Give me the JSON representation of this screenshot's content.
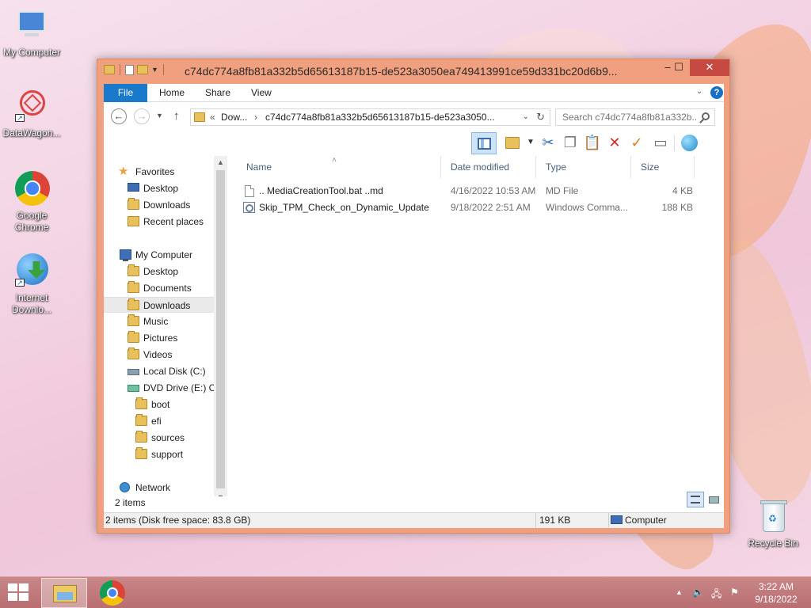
{
  "desktop": {
    "icons": [
      {
        "label": "My Computer"
      },
      {
        "label": "DataWagon..."
      },
      {
        "label": "Google Chrome"
      },
      {
        "label": "Internet Downlo..."
      },
      {
        "label": "Recycle Bin"
      }
    ]
  },
  "window": {
    "title": "c74dc774a8fb81a332b5d65613187b15-de523a3050ea749413991ce59d331bc20d6b9...",
    "controls": {
      "minimize": "–",
      "maximize": "☐",
      "close": "✕"
    }
  },
  "ribbon": {
    "tabs": [
      "File",
      "Home",
      "Share",
      "View"
    ]
  },
  "navigation": {
    "back": "←",
    "forward": "→",
    "up": "↑",
    "address_prefix": "«",
    "address_parent": "Dow...",
    "address_separator": "›",
    "address_current": "c74dc774a8fb81a332b5d65613187b15-de523a3050...",
    "search_placeholder": "Search c74dc774a8fb81a332b..."
  },
  "nav_pane": {
    "favorites": {
      "label": "Favorites",
      "items": [
        "Desktop",
        "Downloads",
        "Recent places"
      ]
    },
    "computer": {
      "label": "My Computer",
      "items": [
        "Desktop",
        "Documents",
        "Downloads",
        "Music",
        "Pictures",
        "Videos",
        "Local Disk (C:)",
        "DVD Drive (E:) CC"
      ],
      "dvd_children": [
        "boot",
        "efi",
        "sources",
        "support"
      ]
    },
    "network": {
      "label": "Network"
    }
  },
  "file_list": {
    "columns": [
      "Name",
      "Date modified",
      "Type",
      "Size"
    ],
    "rows": [
      {
        "name": ".. MediaCreationTool.bat ..md",
        "date": "4/16/2022 10:53 AM",
        "type": "MD File",
        "size": "4 KB"
      },
      {
        "name": "Skip_TPM_Check_on_Dynamic_Update",
        "date": "9/18/2022 2:51 AM",
        "type": "Windows Comma...",
        "size": "188 KB"
      }
    ]
  },
  "status": {
    "item_count": "2 items",
    "summary": "2 items (Disk free space: 83.8 GB)",
    "size": "191 KB",
    "location": "Computer"
  },
  "taskbar": {
    "time": "3:22 AM",
    "date": "9/18/2022"
  },
  "colors": {
    "window_frame": "#f0a07e",
    "file_tab": "#1979ca",
    "close_button": "#c74a42",
    "taskbar": "#c47a7a"
  }
}
